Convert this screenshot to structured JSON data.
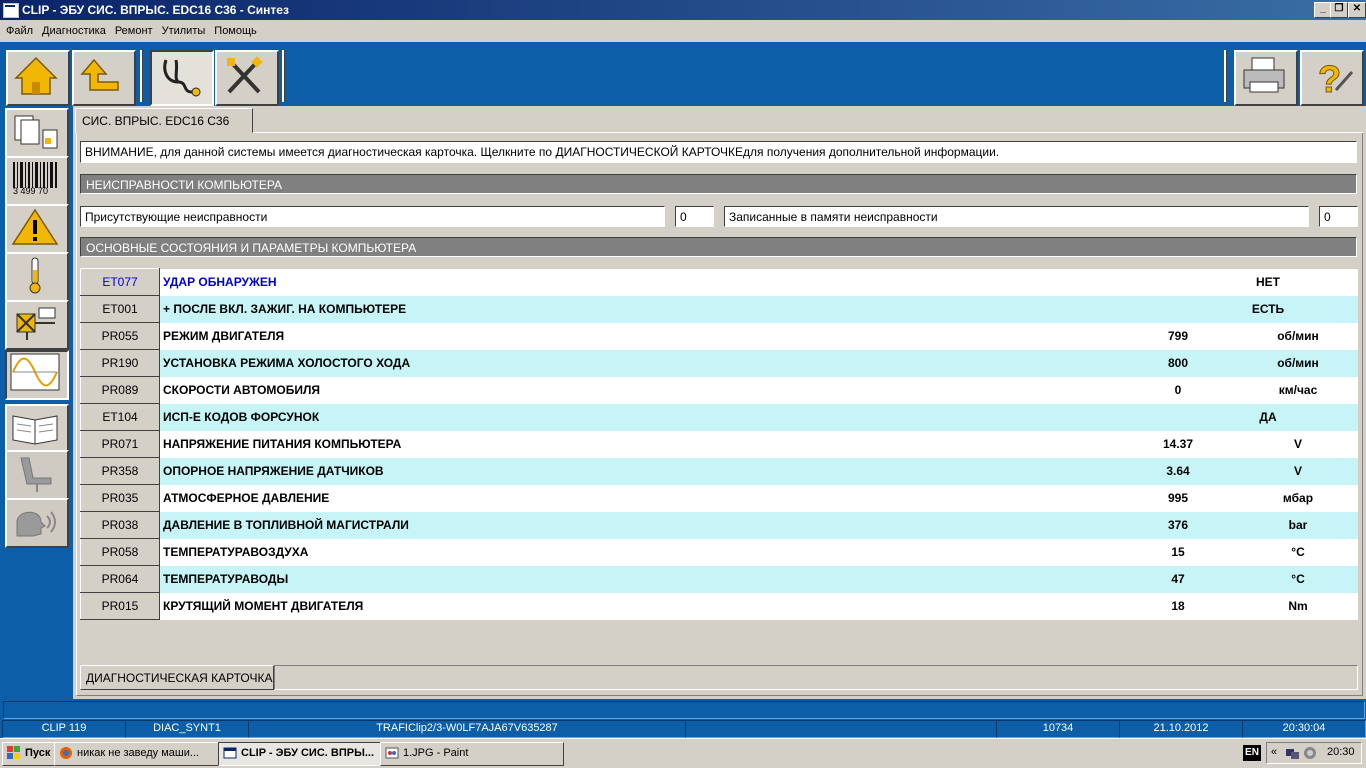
{
  "window": {
    "title": "CLIP - ЭБУ СИС. ВПРЫС. EDC16 C36 - Синтез",
    "controls": [
      "_",
      "❐",
      "✕"
    ]
  },
  "menu": [
    "Файл",
    "Диагностика",
    "Ремонт",
    "Утилиты",
    "Помощь"
  ],
  "toolbar": {
    "left": [
      "home-icon",
      "back-up-icon",
      "stethoscope-icon",
      "tools-icon"
    ],
    "right": [
      "printer-icon",
      "help-icon"
    ]
  },
  "sidebar": {
    "items": [
      "documents-icon",
      "barcode-icon",
      "warning-icon",
      "thermometer-icon",
      "actuator-icon",
      "oscilloscope-icon",
      "book-icon",
      "seat-icon",
      "voice-icon"
    ],
    "barcode_text": "3 499 70"
  },
  "tab": {
    "label": "СИС. ВПРЫС. EDC16 C36"
  },
  "notice": "ВНИМАНИЕ, для данной системы имеется диагностическая карточка. Щелкните по ДИАГНОСТИЧЕСКОЙ КАРТОЧКЕдля получения дополнительной информации.",
  "faults": {
    "section_title": "НЕИСПРАВНОСТИ КОМПЬЮТЕРА",
    "present_label": "Присутствующие неисправности",
    "present_count": "0",
    "stored_label": "Записанные в памяти неисправности",
    "stored_count": "0"
  },
  "params": {
    "section_title": "ОСНОВНЫЕ СОСТОЯНИЯ И ПАРАМЕТРЫ КОМПЬЮТЕРА",
    "rows": [
      {
        "code": "ET077",
        "name": "УДАР ОБНАРУЖЕН",
        "status": "НЕТ"
      },
      {
        "code": "ET001",
        "name": "+ ПОСЛЕ ВКЛ. ЗАЖИГ. НА КОМПЬЮТЕРЕ",
        "status": "ЕСТЬ"
      },
      {
        "code": "PR055",
        "name": "РЕЖИМ ДВИГАТЕЛЯ",
        "value": "799",
        "unit": "об/мин"
      },
      {
        "code": "PR190",
        "name": "УСТАНОВКА РЕЖИМА ХОЛОСТОГО ХОДА",
        "value": "800",
        "unit": "об/мин"
      },
      {
        "code": "PR089",
        "name": "СКОРОСТИ АВТОМОБИЛЯ",
        "value": "0",
        "unit": "км/час"
      },
      {
        "code": "ET104",
        "name": "ИСП-Е КОДОВ ФОРСУНОК",
        "status": "ДА"
      },
      {
        "code": "PR071",
        "name": "НАПРЯЖЕНИЕ ПИТАНИЯ КОМПЬЮТЕРА",
        "value": "14.37",
        "unit": "V"
      },
      {
        "code": "PR358",
        "name": "ОПОРНОЕ НАПРЯЖЕНИЕ ДАТЧИКОВ",
        "value": "3.64",
        "unit": "V"
      },
      {
        "code": "PR035",
        "name": "АТМОСФЕРНОЕ ДАВЛЕНИЕ",
        "value": "995",
        "unit": "мбар"
      },
      {
        "code": "PR038",
        "name": "ДАВЛЕНИЕ В ТОПЛИВНОЙ МАГИСТРАЛИ",
        "value": "376",
        "unit": "bar"
      },
      {
        "code": "PR058",
        "name": "ТЕМПЕРАТУРАВОЗДУХА",
        "value": "15",
        "unit": "°C"
      },
      {
        "code": "PR064",
        "name": "ТЕМПЕРАТУРАВОДЫ",
        "value": "47",
        "unit": "°C"
      },
      {
        "code": "PR015",
        "name": "КРУТЯЩИЙ МОМЕНТ ДВИГАТЕЛЯ",
        "value": "18",
        "unit": "Nm"
      }
    ]
  },
  "diag_card_button": "ДИАГНОСТИЧЕСКАЯ КАРТОЧКА",
  "statusbar": {
    "version": "CLIP 119",
    "mode": "DIAC_SYNT1",
    "vehicle": "TRAFIClip2/3-W0LF7AJA67V635287",
    "code": "10734",
    "date": "21.10.2012",
    "time": "20:30:04"
  },
  "taskbar": {
    "start": "Пуск",
    "tasks": [
      {
        "label": "никак не заведу маши...",
        "icon": "firefox-icon"
      },
      {
        "label": "CLIP - ЭБУ СИС. ВПРЫ...",
        "icon": "clip-window-icon"
      },
      {
        "label": "1.JPG - Paint",
        "icon": "paint-icon"
      }
    ],
    "lang": "EN",
    "clock": "20:30"
  },
  "colors": {
    "desktop_blue": "#0b5ea7",
    "row_alt": "#c7f5f7",
    "code_blue": "#0000cc"
  }
}
